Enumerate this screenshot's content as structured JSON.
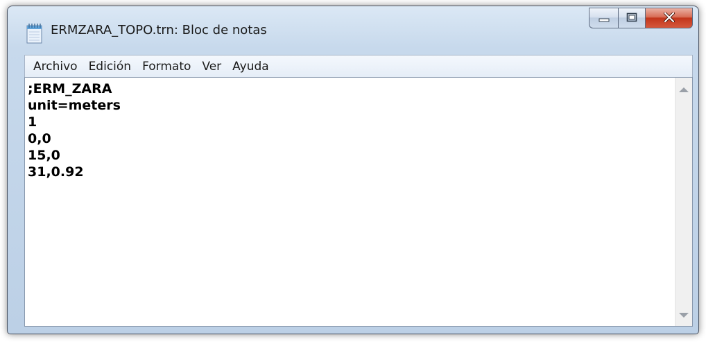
{
  "window": {
    "title": "ERMZARA_TOPO.trn: Bloc de notas",
    "app_icon": "notepad-icon",
    "buttons": {
      "minimize_icon": "minimize-icon",
      "maximize_icon": "maximize-icon",
      "close_icon": "close-icon",
      "close_color": "#c7391c"
    }
  },
  "menu": {
    "items": [
      "Archivo",
      "Edición",
      "Formato",
      "Ver",
      "Ayuda"
    ]
  },
  "editor": {
    "lines": [
      ";ERM_ZARA",
      "unit=meters",
      "1",
      "0,0",
      "15,0",
      "31,0.92"
    ]
  },
  "scrollbar": {
    "up_icon": "scroll-up-arrow-icon",
    "down_icon": "scroll-down-arrow-icon"
  }
}
